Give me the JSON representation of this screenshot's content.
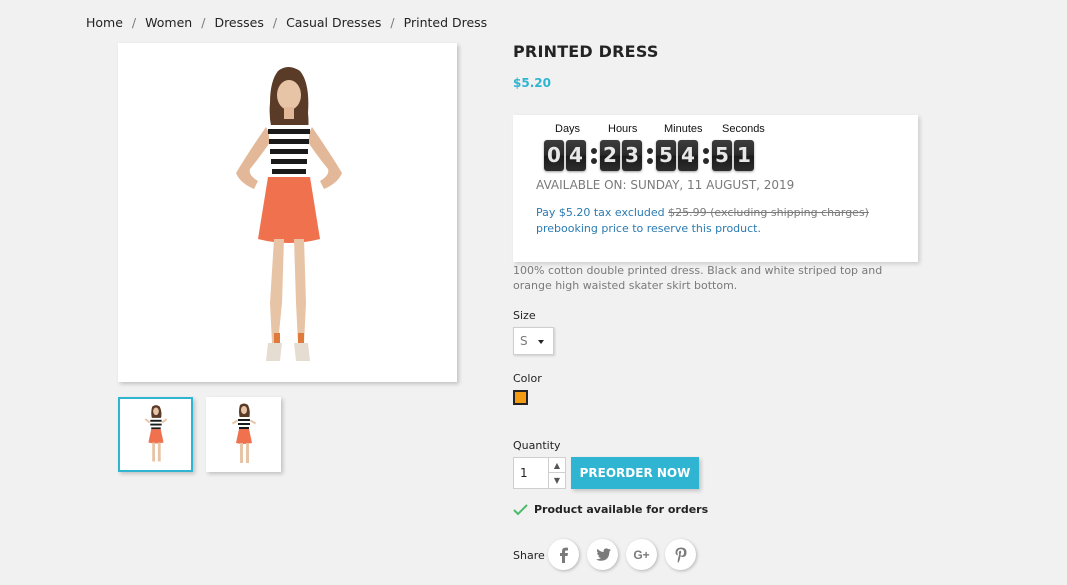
{
  "breadcrumb": [
    "Home",
    "Women",
    "Dresses",
    "Casual Dresses",
    "Printed Dress"
  ],
  "breadcrumb_separator": "/",
  "product": {
    "title": "Printed Dress",
    "price": "$5.20",
    "description": "100% cotton double printed dress. Black and white striped top and orange high waisted skater skirt bottom."
  },
  "countdown": {
    "labels": {
      "days": "Days",
      "hours": "Hours",
      "minutes": "Minutes",
      "seconds": "Seconds"
    },
    "days": [
      "0",
      "4"
    ],
    "hours": [
      "2",
      "3"
    ],
    "minutes": [
      "5",
      "4"
    ],
    "seconds": [
      "5",
      "1"
    ]
  },
  "preorder": {
    "available_on": "Available on: Sunday, 11 August, 2019",
    "pay_prefix": "Pay $5.20 tax excluded ",
    "original_price": "$25.99",
    "excluding": " (excluding shipping charges)",
    "pay_suffix": " prebooking price to reserve this product."
  },
  "options": {
    "size_label": "Size",
    "size_value": "S",
    "color_label": "Color",
    "color_swatch": "#f39c11",
    "quantity_label": "Quantity",
    "quantity_value": "1"
  },
  "actions": {
    "preorder_label": "Preorder now",
    "availability_text": "Product available for orders",
    "share_label": "Share"
  },
  "colors": {
    "accent": "#2fb5d2",
    "background": "#f1f1f1",
    "check": "#4cbb6c"
  },
  "share_icons": [
    "facebook-icon",
    "twitter-icon",
    "google-plus-icon",
    "pinterest-icon"
  ]
}
